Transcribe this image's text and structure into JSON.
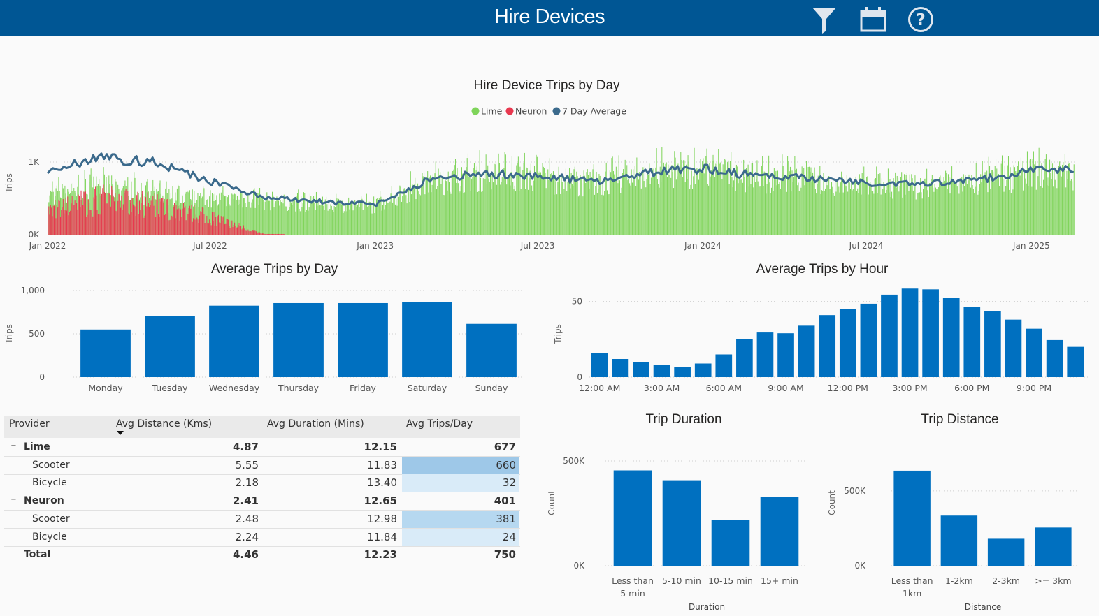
{
  "header": {
    "title": "Hire Devices",
    "icons": [
      "filter-icon",
      "calendar-icon",
      "help-icon"
    ]
  },
  "colors": {
    "header_bg": "#005694",
    "bar": "#0070c0",
    "lime": "#7fd45a",
    "neuron": "#e8384f",
    "avg": "#3b6a8c"
  },
  "charts": {
    "trips_by_day": {
      "title": "Hire Device Trips by Day",
      "legend": [
        {
          "label": "Lime",
          "color": "#7fd45a"
        },
        {
          "label": "Neuron",
          "color": "#e8384f"
        },
        {
          "label": "7 Day Average",
          "color": "#3b6a8c"
        }
      ],
      "ylabel": "Trips",
      "yticks": [
        "0K",
        "1K"
      ],
      "xticks": [
        "Jan 2022",
        "Jul 2022",
        "Jan 2023",
        "Jul 2023",
        "Jan 2024",
        "Jul 2024",
        "Jan 2025"
      ]
    },
    "by_day": {
      "title": "Average Trips by Day",
      "ylabel": "Trips",
      "yticks": [
        "0",
        "500",
        "1,000"
      ]
    },
    "by_hour": {
      "title": "Average Trips by Hour",
      "ylabel": "Trips",
      "yticks": [
        "0",
        "50"
      ],
      "xticks": [
        "12:00 AM",
        "3:00 AM",
        "6:00 AM",
        "9:00 AM",
        "12:00 PM",
        "3:00 PM",
        "6:00 PM",
        "9:00 PM"
      ]
    },
    "duration": {
      "title": "Trip Duration",
      "ylabel": "Count",
      "xlabel": "Duration",
      "yticks": [
        "0K",
        "500K"
      ]
    },
    "distance": {
      "title": "Trip Distance",
      "ylabel": "Count",
      "xlabel": "Distance",
      "yticks": [
        "0K",
        "500K"
      ]
    }
  },
  "table": {
    "headers": [
      "Provider",
      "Avg Distance (Kms)",
      "Avg Duration (Mins)",
      "Avg Trips/Day"
    ],
    "rows": [
      {
        "type": "group",
        "name": "Lime",
        "dist": "4.87",
        "dur": "12.15",
        "trips": "677"
      },
      {
        "type": "child",
        "name": "Scooter",
        "dist": "5.55",
        "dur": "11.83",
        "trips": "660"
      },
      {
        "type": "child",
        "name": "Bicycle",
        "dist": "2.18",
        "dur": "13.40",
        "trips": "32"
      },
      {
        "type": "group",
        "name": "Neuron",
        "dist": "2.41",
        "dur": "12.65",
        "trips": "401"
      },
      {
        "type": "child",
        "name": "Scooter",
        "dist": "2.48",
        "dur": "12.98",
        "trips": "381"
      },
      {
        "type": "child",
        "name": "Bicycle",
        "dist": "2.24",
        "dur": "11.84",
        "trips": "24"
      },
      {
        "type": "total",
        "name": "Total",
        "dist": "4.46",
        "dur": "12.23",
        "trips": "750"
      }
    ]
  },
  "chart_data": [
    {
      "type": "line",
      "title": "Hire Device Trips by Day",
      "ylabel": "Trips",
      "ylim": [
        0,
        1500
      ],
      "x": [
        "2022-01",
        "2022-03",
        "2022-05",
        "2022-07",
        "2022-09",
        "2022-11",
        "2023-01",
        "2023-03",
        "2023-05",
        "2023-07",
        "2023-09",
        "2023-11",
        "2024-01",
        "2024-03",
        "2024-05",
        "2024-07",
        "2024-09",
        "2024-11",
        "2025-01"
      ],
      "series": [
        {
          "name": "Lime",
          "values": [
            560,
            720,
            560,
            520,
            480,
            440,
            420,
            760,
            850,
            820,
            740,
            860,
            920,
            820,
            790,
            720,
            700,
            750,
            880
          ]
        },
        {
          "name": "Neuron",
          "values": [
            320,
            480,
            400,
            240,
            0,
            0,
            0,
            0,
            0,
            0,
            0,
            0,
            0,
            0,
            0,
            0,
            0,
            0,
            0
          ]
        },
        {
          "name": "7 Day Average",
          "values": [
            880,
            1070,
            1000,
            740,
            520,
            460,
            420,
            760,
            850,
            820,
            740,
            860,
            920,
            820,
            790,
            720,
            700,
            750,
            900
          ]
        }
      ]
    },
    {
      "type": "bar",
      "title": "Average Trips by Day",
      "ylabel": "Trips",
      "categories": [
        "Monday",
        "Tuesday",
        "Wednesday",
        "Thursday",
        "Friday",
        "Saturday",
        "Sunday"
      ],
      "values": [
        550,
        705,
        825,
        855,
        855,
        865,
        615
      ],
      "ylim": [
        0,
        1000
      ]
    },
    {
      "type": "bar",
      "title": "Average Trips by Hour",
      "ylabel": "Trips",
      "categories": [
        "12:00 AM",
        "1:00 AM",
        "2:00 AM",
        "3:00 AM",
        "4:00 AM",
        "5:00 AM",
        "6:00 AM",
        "7:00 AM",
        "8:00 AM",
        "9:00 AM",
        "10:00 AM",
        "11:00 AM",
        "12:00 PM",
        "1:00 PM",
        "2:00 PM",
        "3:00 PM",
        "4:00 PM",
        "5:00 PM",
        "6:00 PM",
        "7:00 PM",
        "8:00 PM",
        "9:00 PM",
        "10:00 PM",
        "11:00 PM"
      ],
      "values": [
        16,
        12,
        10,
        8,
        6.5,
        9,
        15,
        25,
        29.5,
        29,
        34,
        41,
        45,
        48.5,
        54.5,
        58.5,
        58,
        52.5,
        46.5,
        43.5,
        38,
        32,
        24.5,
        20
      ],
      "ylim": [
        0,
        60
      ]
    },
    {
      "type": "bar",
      "title": "Trip Duration",
      "xlabel": "Duration",
      "ylabel": "Count",
      "categories": [
        "Less than 5 min",
        "5-10 min",
        "10-15 min",
        "15+ min"
      ],
      "values": [
        455000,
        408000,
        217000,
        327000
      ],
      "ylim": [
        0,
        500000
      ]
    },
    {
      "type": "bar",
      "title": "Trip Distance",
      "xlabel": "Distance",
      "ylabel": "Count",
      "categories": [
        "Less than 1km",
        "1-2km",
        "2-3km",
        ">= 3km"
      ],
      "values": [
        635000,
        335000,
        180000,
        255000
      ],
      "ylim": [
        0,
        700000
      ]
    }
  ]
}
